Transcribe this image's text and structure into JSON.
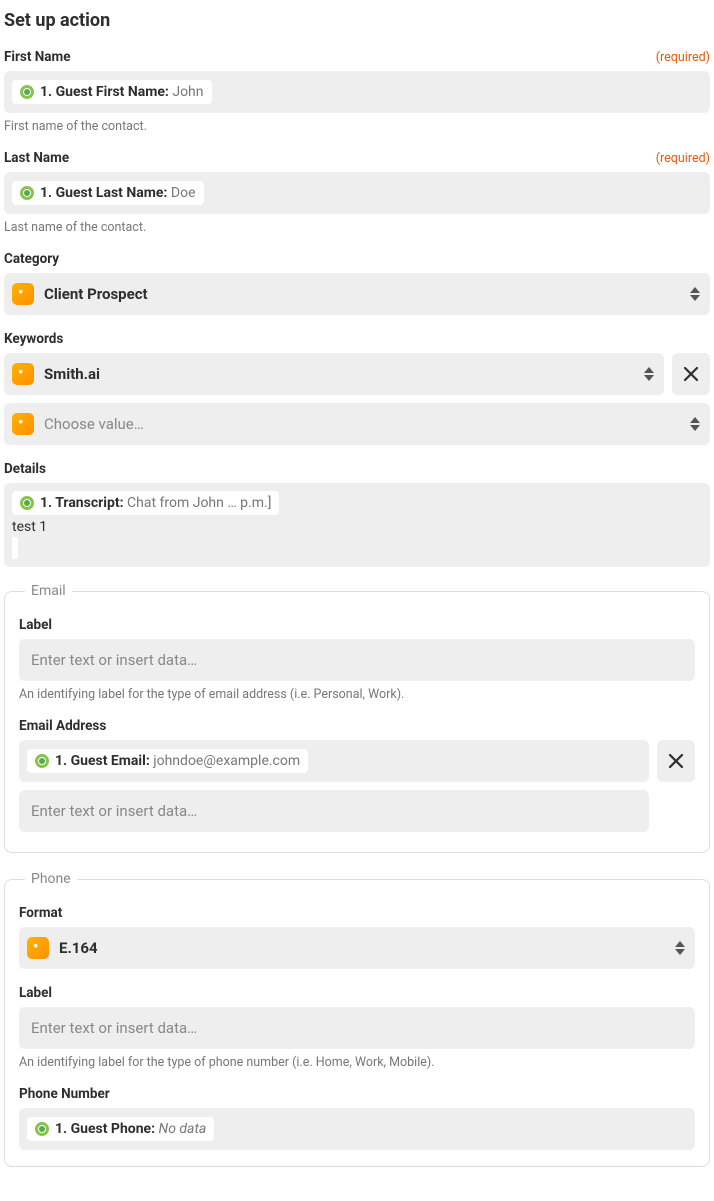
{
  "title": "Set up action",
  "required_label": "(required)",
  "placeholders": {
    "text_or_data": "Enter text or insert data…",
    "choose_value": "Choose value…"
  },
  "fields": {
    "first_name": {
      "label": "First Name",
      "pill_label": "1. Guest First Name:",
      "pill_value": "John",
      "helper": "First name of the contact."
    },
    "last_name": {
      "label": "Last Name",
      "pill_label": "1. Guest Last Name:",
      "pill_value": "Doe",
      "helper": "Last name of the contact."
    },
    "category": {
      "label": "Category",
      "value": "Client Prospect"
    },
    "keywords": {
      "label": "Keywords",
      "value": "Smith.ai"
    },
    "details": {
      "label": "Details",
      "pill_label": "1. Transcript:",
      "pill_value": "Chat from John … p.m.]",
      "static_text": "test 1"
    }
  },
  "email": {
    "legend": "Email",
    "label_field": {
      "label": "Label",
      "helper": "An identifying label for the type of email address (i.e. Personal, Work)."
    },
    "address": {
      "label": "Email Address",
      "pill_label": "1. Guest Email:",
      "pill_value": "johndoe@example.com"
    }
  },
  "phone": {
    "legend": "Phone",
    "format": {
      "label": "Format",
      "value": "E.164"
    },
    "label_field": {
      "label": "Label",
      "helper": "An identifying label for the type of phone number (i.e. Home, Work, Mobile)."
    },
    "number": {
      "label": "Phone Number",
      "pill_label": "1. Guest Phone:",
      "pill_nodata": "No data"
    }
  }
}
